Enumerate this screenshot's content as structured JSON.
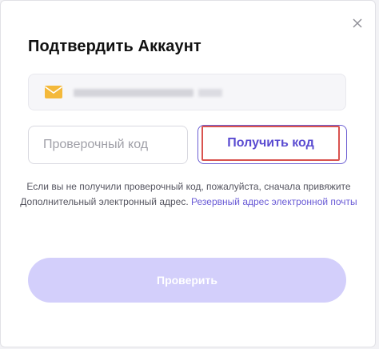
{
  "dialog": {
    "title": "Подтвердить Аккаунт",
    "close_icon": "close-icon"
  },
  "email_field": {
    "icon": "mail-icon",
    "value_masked": true
  },
  "code_input": {
    "placeholder": "Проверочный код",
    "value": ""
  },
  "get_code_button": {
    "label": "Получить код"
  },
  "help": {
    "text": "Если вы не получили проверочный код, пожалуйста, сначала привяжите Дополнительный электронный адрес.",
    "link": "Резервный адрес электронной почты"
  },
  "verify_button": {
    "label": "Проверить",
    "disabled": true
  },
  "colors": {
    "accent": "#5a4bd1",
    "link": "#6a5bd6",
    "verify_disabled_bg": "#d3cffb",
    "highlight_border": "#d9534f",
    "mail_icon": "#f4b93b"
  }
}
